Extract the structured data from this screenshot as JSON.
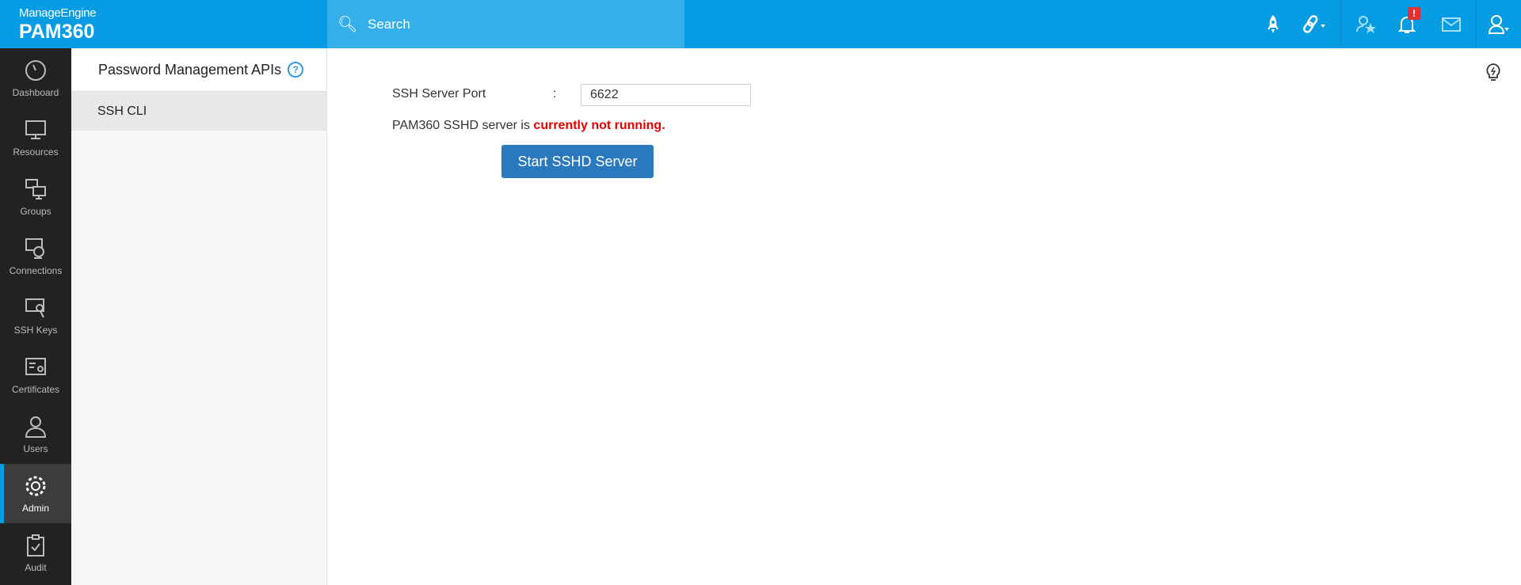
{
  "header": {
    "brand": "ManageEngine",
    "product": "PAM360",
    "search_placeholder": "Search",
    "notification_badge": "!"
  },
  "sidebar": {
    "items": [
      {
        "label": "Dashboard"
      },
      {
        "label": "Resources"
      },
      {
        "label": "Groups"
      },
      {
        "label": "Connections"
      },
      {
        "label": "SSH Keys"
      },
      {
        "label": "Certificates"
      },
      {
        "label": "Users"
      },
      {
        "label": "Admin",
        "active": true
      },
      {
        "label": "Audit"
      }
    ]
  },
  "panel": {
    "title": "Password Management APIs",
    "help": "?",
    "items": [
      {
        "label": "SSH CLI"
      }
    ]
  },
  "main": {
    "port_label": "SSH Server Port",
    "colon": ":",
    "port_value": "6622",
    "status_prefix": "PAM360 SSHD server is ",
    "status_value": "currently not running.",
    "start_button": "Start SSHD Server"
  },
  "colors": {
    "brand": "#059ce4",
    "button": "#2a78bd",
    "error": "#e60000"
  }
}
